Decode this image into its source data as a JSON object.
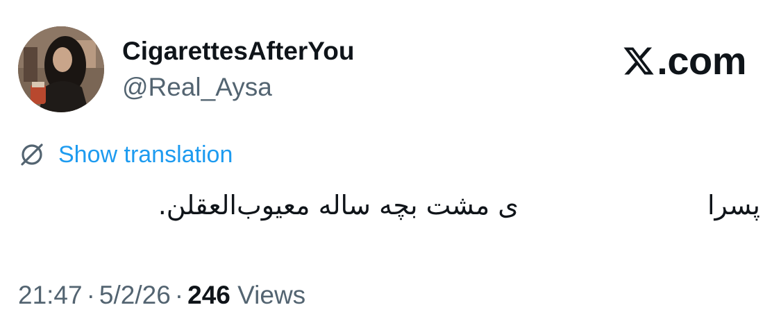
{
  "author": {
    "display_name": "CigarettesAfterYou",
    "handle": "@Real_Aysa"
  },
  "brand": {
    "text": ".com",
    "icon": "x-logo-icon"
  },
  "translation": {
    "link_label": "Show translation",
    "icon": "globe-icon"
  },
  "tweet": {
    "text_part1": "پسرا",
    "text_part2": "ی مشت بچه ساله معیوب‌العقلن."
  },
  "meta": {
    "time": "21:47",
    "separator": "·",
    "date": "5/2/26",
    "views_count": "246",
    "views_label": "Views"
  },
  "colors": {
    "link": "#1d9bf0",
    "secondary_text": "#536471",
    "primary_text": "#0f1419"
  }
}
